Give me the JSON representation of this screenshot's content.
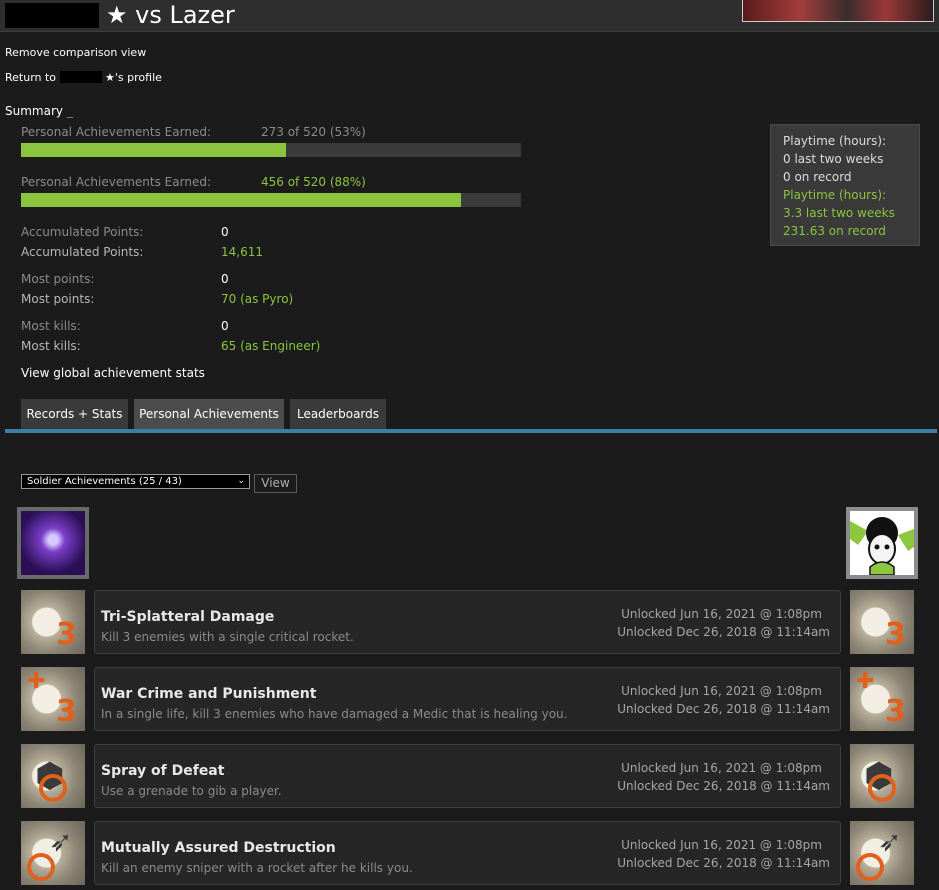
{
  "header": {
    "title": "★ vs Lazer"
  },
  "links": {
    "remove_comparison": "Remove comparison view",
    "return_prefix": "Return to",
    "return_suffix": "★'s profile"
  },
  "summary": {
    "title": "Summary",
    "rows": [
      {
        "label": "Personal Achievements Earned:",
        "value": "273 of 520 (53%)",
        "progress": 0.53
      },
      {
        "label": "Personal Achievements Earned:",
        "value": "456 of 520 (88%)",
        "progress": 0.88
      }
    ],
    "accumulated_points": {
      "label": "Accumulated Points:",
      "them": "0",
      "me": "14,611"
    },
    "most_points": {
      "label": "Most points:",
      "them": "0",
      "me": "70 (as Pyro)"
    },
    "most_kills": {
      "label": "Most kills:",
      "them": "0",
      "me": "65 (as Engineer)"
    },
    "global_stats_link": "View global achievement stats"
  },
  "playtime": {
    "them_label": "Playtime (hours):",
    "them_two_weeks": "0 last two weeks",
    "them_record": "0 on record",
    "me_label": "Playtime (hours):",
    "me_two_weeks": "3.3 last two weeks",
    "me_record": "231.63 on record"
  },
  "tabs": [
    {
      "label": "Records + Stats",
      "active": false
    },
    {
      "label": "Personal Achievements",
      "active": true
    },
    {
      "label": "Leaderboards",
      "active": false
    }
  ],
  "filter": {
    "selected": "Soldier Achievements (25 / 43)",
    "view_button": "View"
  },
  "achievements": [
    {
      "name": "Tri-Splatteral Damage",
      "description": "Kill 3 enemies with a single critical rocket.",
      "unlock_them": "Unlocked Jun 16, 2021 @ 1:08pm",
      "unlock_me": "Unlocked Dec 26, 2018 @ 11:14am",
      "icon": "explosion-three-icon"
    },
    {
      "name": "War Crime and Punishment",
      "description": "In a single life, kill 3 enemies who have damaged a Medic that is healing you.",
      "unlock_them": "Unlocked Jun 16, 2021 @ 1:08pm",
      "unlock_me": "Unlocked Dec 26, 2018 @ 11:14am",
      "icon": "medic-cross-three-icon"
    },
    {
      "name": "Spray of Defeat",
      "description": "Use a grenade to gib a player.",
      "unlock_them": "Unlocked Jun 16, 2021 @ 1:08pm",
      "unlock_me": "Unlocked Dec 26, 2018 @ 11:14am",
      "icon": "grenade-icon"
    },
    {
      "name": "Mutually Assured Destruction",
      "description": "Kill an enemy sniper with a rocket after he kills you.",
      "unlock_them": "Unlocked Jun 16, 2021 @ 1:08pm",
      "unlock_me": "Unlocked Dec 26, 2018 @ 11:14am",
      "icon": "rocket-target-icon"
    }
  ]
}
